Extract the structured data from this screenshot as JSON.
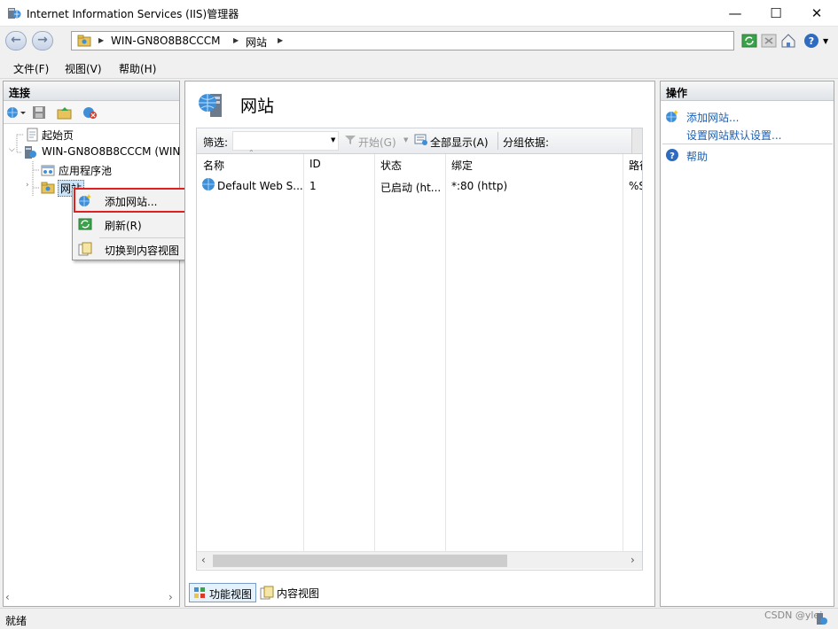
{
  "window": {
    "title": "Internet Information Services (IIS)管理器",
    "minimize": "—",
    "maximize": "☐",
    "close": "✕"
  },
  "address": {
    "back": "←",
    "forward": "→",
    "crumbs": [
      "WIN-GN8O8B8CCCM",
      "网站"
    ]
  },
  "menu": {
    "file": "文件(F)",
    "view": "视图(V)",
    "help": "帮助(H)"
  },
  "connections": {
    "header": "连接",
    "tree": {
      "start": "起始页",
      "server": "WIN-GN8O8B8CCCM (WIN",
      "apppools": "应用程序池",
      "sites": "网站"
    }
  },
  "context_menu": {
    "add_site": "添加网站...",
    "refresh": "刷新(R)",
    "switch_content": "切换到内容视图"
  },
  "main": {
    "title": "网站",
    "filter_label": "筛选:",
    "filter_value": "",
    "start": "开始(G)",
    "show_all": "全部显示(A)",
    "group_by": "分组依据:",
    "columns": [
      "名称",
      "ID",
      "状态",
      "绑定",
      "路径"
    ],
    "rows": [
      {
        "name": "Default Web S...",
        "id": "1",
        "status": "已启动 (ht...",
        "binding": "*:80 (http)",
        "path": "%S"
      }
    ],
    "feature_view": "功能视图",
    "content_view": "内容视图"
  },
  "actions": {
    "header": "操作",
    "add_site": "添加网站...",
    "site_defaults": "设置网站默认设置...",
    "help": "帮助"
  },
  "status": {
    "text": "就绪",
    "watermark": "CSDN @ylei"
  },
  "colors": {
    "link": "#1a5fb4",
    "highlight_border": "#e02020"
  }
}
